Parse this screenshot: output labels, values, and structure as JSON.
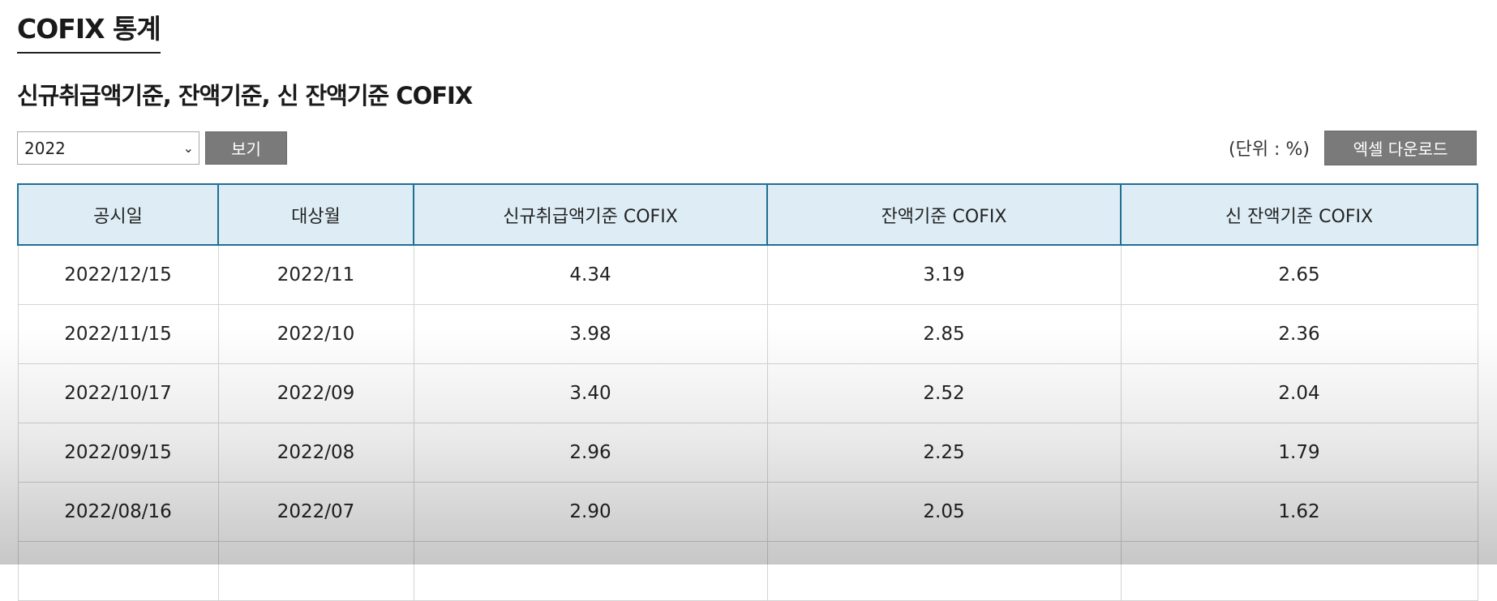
{
  "page": {
    "title": "COFIX 통계",
    "subtitle": "신규취급액기준, 잔액기준, 신 잔액기준 COFIX"
  },
  "controls": {
    "year_selected": "2022",
    "view_label": "보기",
    "unit_label": "(단위 : %)",
    "excel_label": "엑셀 다운로드"
  },
  "table": {
    "headers": [
      "공시일",
      "대상월",
      "신규취급액기준 COFIX",
      "잔액기준 COFIX",
      "신 잔액기준 COFIX"
    ],
    "rows": [
      [
        "2022/12/15",
        "2022/11",
        "4.34",
        "3.19",
        "2.65"
      ],
      [
        "2022/11/15",
        "2022/10",
        "3.98",
        "2.85",
        "2.36"
      ],
      [
        "2022/10/17",
        "2022/09",
        "3.40",
        "2.52",
        "2.04"
      ],
      [
        "2022/09/15",
        "2022/08",
        "2.96",
        "2.25",
        "1.79"
      ],
      [
        "2022/08/16",
        "2022/07",
        "2.90",
        "2.05",
        "1.62"
      ]
    ]
  }
}
